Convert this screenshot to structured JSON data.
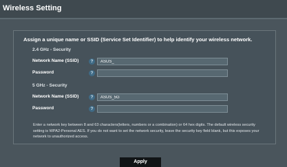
{
  "header": {
    "title": "Wireless Setting"
  },
  "form": {
    "heading": "Assign a unique name or SSID (Service Set Identifier) to help identify your wireless network.",
    "band_24": {
      "section_label": "2.4 GHz - Security",
      "ssid_label": "Network Name (SSID)",
      "ssid_value": "ASUS_",
      "password_label": "Password",
      "password_value": ""
    },
    "band_5": {
      "section_label": "5 GHz - Security",
      "ssid_label": "Network Name (SSID)",
      "ssid_value": "ASUS_5G",
      "password_label": "Password",
      "password_value": ""
    },
    "help_icon_text": "?",
    "note": "Enter a network key between 8 and 63 characters(letters, numbers or a combination) or 64 hex digits. The default wireless security setting is WPA2-Personal AES. If you do not want to set the network security, leave the security key field blank, but this exposes your network to unauthorized access."
  },
  "footer": {
    "apply_label": "Apply"
  },
  "colors": {
    "background": "#4a555c",
    "panel": "#46525a",
    "input": "#576871",
    "help_icon": "#3f6a85",
    "apply_button": "#111416"
  }
}
